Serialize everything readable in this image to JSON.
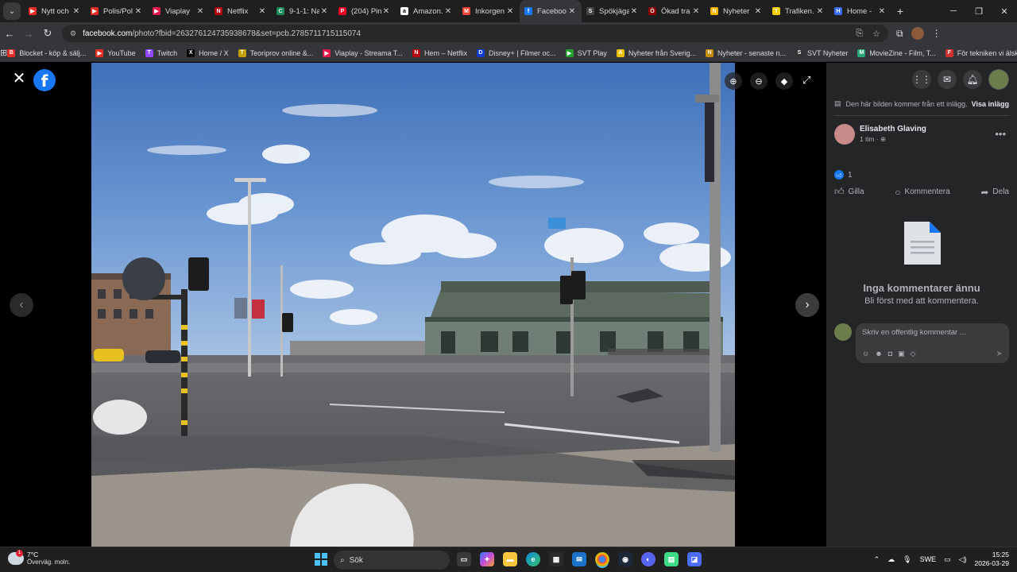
{
  "tabs": [
    {
      "title": "Nytt och",
      "color": "#e52d27",
      "glyph": "▶"
    },
    {
      "title": "Polis/Pol",
      "color": "#e52d27",
      "glyph": "▶"
    },
    {
      "title": "Viaplay",
      "color": "#e3174a",
      "glyph": "▶"
    },
    {
      "title": "Netflix",
      "color": "#b20710",
      "glyph": "N"
    },
    {
      "title": "9-1-1: Na",
      "color": "#1a8c5a",
      "glyph": "C"
    },
    {
      "title": "(204) Pin",
      "color": "#e60023",
      "glyph": "P"
    },
    {
      "title": "Amazon.",
      "color": "#ffffff",
      "glyph": "a"
    },
    {
      "title": "Inkorgen",
      "color": "#ea4335",
      "glyph": "M"
    },
    {
      "title": "Faceboo",
      "color": "#1877f2",
      "glyph": "f",
      "active": true
    },
    {
      "title": "Spökjäga",
      "color": "#444444",
      "glyph": "S"
    },
    {
      "title": "Ökad tra",
      "color": "#8b0000",
      "glyph": "Ö"
    },
    {
      "title": "Nyheter",
      "color": "#f7b500",
      "glyph": "N"
    },
    {
      "title": "Trafiken.",
      "color": "#f5d000",
      "glyph": "T"
    },
    {
      "title": "Home -",
      "color": "#3b6cf6",
      "glyph": "H"
    }
  ],
  "address": {
    "host": "facebook.com",
    "path": "/photo?fbid=2632761247359386​78&set=pcb.2785711715115074"
  },
  "bookmarks": [
    {
      "label": "Blocket - köp & sälj...",
      "color": "#e52d27",
      "glyph": "B"
    },
    {
      "label": "YouTube",
      "color": "#e52d27",
      "glyph": "▶"
    },
    {
      "label": "Twitch",
      "color": "#9146ff",
      "glyph": "T"
    },
    {
      "label": "Home / X",
      "color": "#000000",
      "glyph": "X"
    },
    {
      "label": "Teoriprov online &...",
      "color": "#c4a000",
      "glyph": "T"
    },
    {
      "label": "Viaplay - Streama T...",
      "color": "#e3174a",
      "glyph": "▶"
    },
    {
      "label": "Hem – Netflix",
      "color": "#b20710",
      "glyph": "N"
    },
    {
      "label": "Disney+ | Filmer oc...",
      "color": "#113ccf",
      "glyph": "D"
    },
    {
      "label": "SVT Play",
      "color": "#20a030",
      "glyph": "▶"
    },
    {
      "label": "Nyheter från Sverig...",
      "color": "#e8c000",
      "glyph": "A"
    },
    {
      "label": "Nyheter - senaste n...",
      "color": "#c48a00",
      "glyph": "N"
    },
    {
      "label": "SVT Nyheter",
      "color": "#333333",
      "glyph": "S"
    },
    {
      "label": "MovieZine - Film, T...",
      "color": "#2aa876",
      "glyph": "M"
    },
    {
      "label": "För tekniken vi älska...",
      "color": "#d0302f",
      "glyph": "F"
    }
  ],
  "panel": {
    "notice": "Den här bilden kommer från ett inlägg.",
    "notice_link": "Visa inlägg",
    "author": "Elisabeth Glaving",
    "time": "1 tim · ⊕",
    "like_count": "1",
    "like_label": "Gilla",
    "comment_label": "Kommentera",
    "share_label": "Dela",
    "empty_title": "Inga kommentarer ännu",
    "empty_sub": "Bli först med att kommentera.",
    "comment_placeholder": "Skriv en offentlig kommentar ..."
  },
  "taskbar": {
    "temp": "7°C",
    "weather": "Överväg. moln.",
    "weather_badge": "1",
    "search": "Sök",
    "lang": "SWE",
    "time": "15:25",
    "date": "2026-03-29"
  }
}
